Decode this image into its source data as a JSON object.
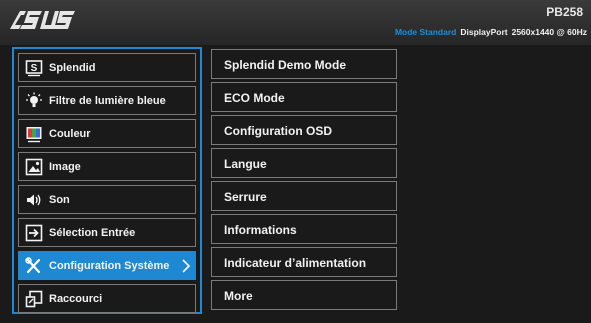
{
  "header": {
    "logo_text": "ASUS",
    "model": "PB258",
    "status": {
      "mode": "Mode Standard",
      "port": "DisplayPort",
      "resolution": "2560x1440 @ 60Hz"
    }
  },
  "main_menu": {
    "items": [
      {
        "label": "Splendid",
        "icon": "splendid-s-icon"
      },
      {
        "label": "Filtre de lumière bleue",
        "icon": "blue-light-bulb-icon"
      },
      {
        "label": "Couleur",
        "icon": "color-palette-icon"
      },
      {
        "label": "Image",
        "icon": "image-icon"
      },
      {
        "label": "Son",
        "icon": "speaker-icon"
      },
      {
        "label": "Sélection Entrée",
        "icon": "input-select-icon"
      },
      {
        "label": "Configuration Système",
        "icon": "wrench-screwdriver-icon",
        "selected": true
      },
      {
        "label": "Raccourci",
        "icon": "shortcut-icon"
      }
    ]
  },
  "sub_menu": {
    "items": [
      {
        "label": "Splendid Demo Mode"
      },
      {
        "label": "ECO Mode"
      },
      {
        "label": "Configuration OSD"
      },
      {
        "label": "Langue"
      },
      {
        "label": "Serrure"
      },
      {
        "label": "Informations"
      },
      {
        "label": "Indicateur d’alimentation"
      },
      {
        "label": "More"
      }
    ]
  },
  "colors": {
    "accent": "#1e88d2",
    "background": "#1a1a1a",
    "border": "#7a7a7a",
    "text": "#f2f2f2"
  }
}
